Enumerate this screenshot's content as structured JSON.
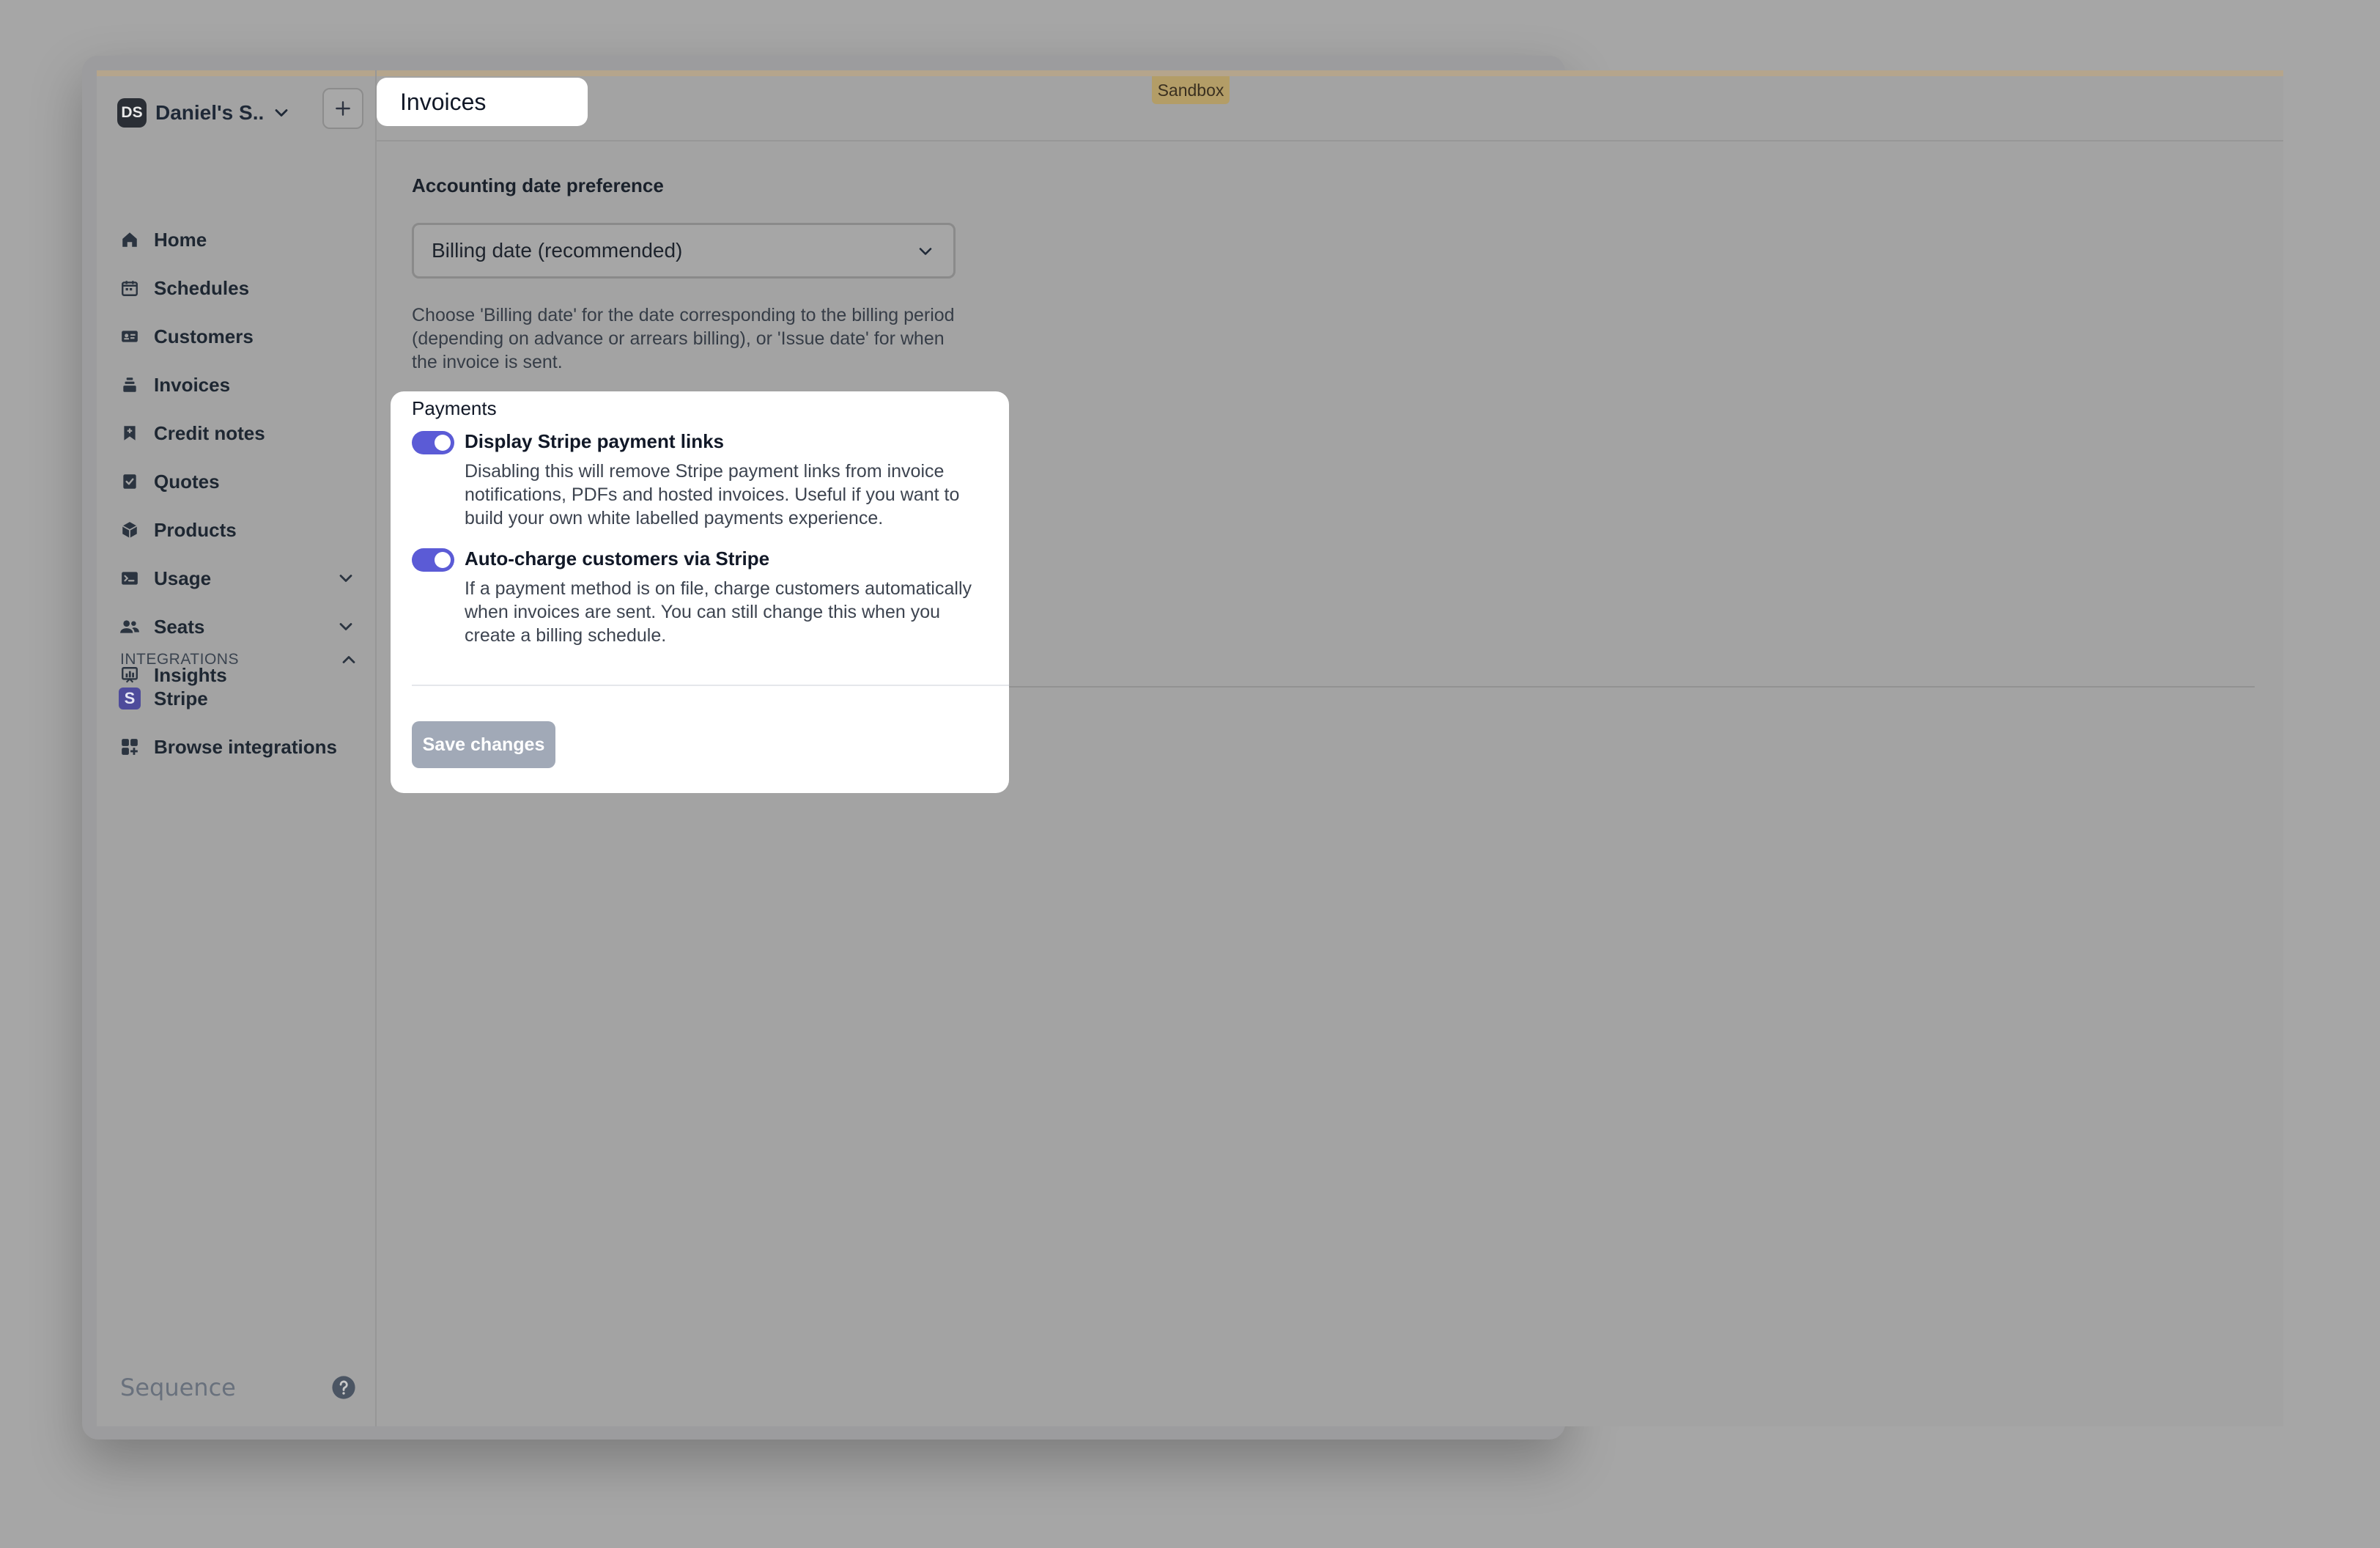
{
  "environment_badge": "Sandbox",
  "workspace": {
    "badge": "DS",
    "name": "Daniel's S..."
  },
  "sidebar": {
    "items": [
      {
        "label": "Home",
        "icon": "home-icon"
      },
      {
        "label": "Schedules",
        "icon": "calendar-icon"
      },
      {
        "label": "Customers",
        "icon": "id-card-icon"
      },
      {
        "label": "Invoices",
        "icon": "invoice-stack-icon"
      },
      {
        "label": "Credit notes",
        "icon": "bookmark-note-icon"
      },
      {
        "label": "Quotes",
        "icon": "check-document-icon"
      },
      {
        "label": "Products",
        "icon": "cube-icon"
      },
      {
        "label": "Usage",
        "icon": "terminal-icon"
      },
      {
        "label": "Seats",
        "icon": "users-icon"
      },
      {
        "label": "Insights",
        "icon": "chart-icon"
      }
    ],
    "integrations_heading": "INTEGRATIONS",
    "integrations": [
      {
        "label": "Stripe",
        "icon": "stripe-icon",
        "glyph": "S"
      },
      {
        "label": "Browse integrations",
        "icon": "grid-icon"
      }
    ],
    "brand": "Sequence"
  },
  "page": {
    "title": "Invoices",
    "accounting": {
      "label": "Accounting date preference",
      "selected": "Billing date (recommended)",
      "help": "Choose 'Billing date' for the date corresponding to the billing period (depending on advance or arrears billing), or 'Issue date' for when the invoice is sent."
    },
    "payments": {
      "title": "Payments",
      "options": [
        {
          "title": "Display Stripe payment links",
          "description": "Disabling this will remove Stripe payment links from invoice notifications, PDFs and hosted invoices. Useful if you want to build your own white labelled payments experience.",
          "enabled": true
        },
        {
          "title": "Auto-charge customers via Stripe",
          "description": "If a payment method is on file, charge customers automatically when invoices are sent. You can still change this when you create a billing schedule.",
          "enabled": true
        }
      ]
    },
    "save_label": "Save changes"
  },
  "colors": {
    "accent": "#5b5bd6",
    "sandbox": "#b39d67"
  }
}
